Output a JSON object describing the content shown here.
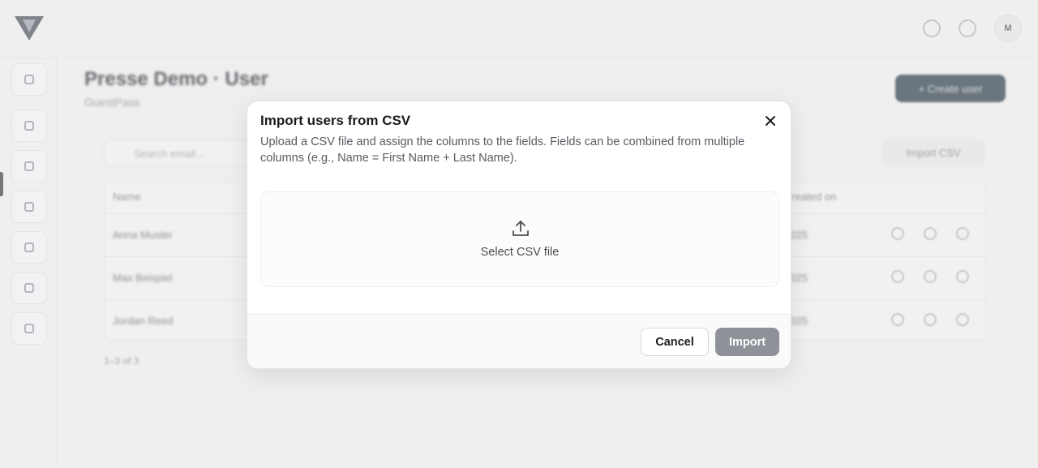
{
  "header": {
    "avatar_initials": "M"
  },
  "page": {
    "title": "Presse Demo · User",
    "subtitle": "GuestPass",
    "create_label": "+ Create user",
    "search_placeholder": "Search email...",
    "import_csv_label": "Import CSV"
  },
  "table": {
    "columns": [
      "Name",
      "Created on"
    ],
    "rows": [
      {
        "name": "Anna Muster",
        "date": "2025"
      },
      {
        "name": "Max Beispiel",
        "date": "2025"
      },
      {
        "name": "Jordan Reed",
        "date": "2025"
      }
    ],
    "pager": "1–3 of 3"
  },
  "modal": {
    "title": "Import users from CSV",
    "description": "Upload a CSV file and assign the columns to the fields. Fields can be combined from multiple columns (e.g., Name = First Name + Last Name).",
    "dropzone_label": "Select CSV file",
    "upload_icon": "upload-icon",
    "close_icon": "close-icon",
    "cancel_label": "Cancel",
    "import_label": "Import",
    "import_disabled_color": "#8e9298"
  }
}
